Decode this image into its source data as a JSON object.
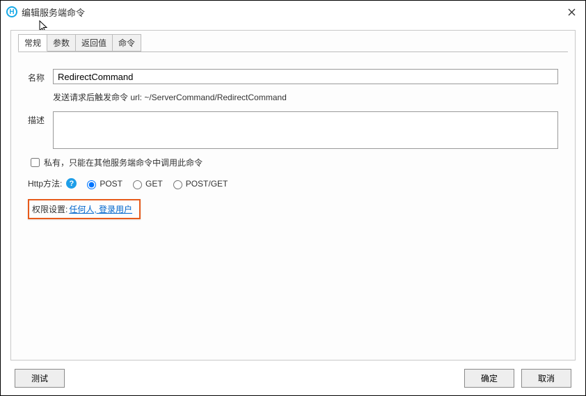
{
  "window": {
    "title": "编辑服务端命令"
  },
  "tabs": {
    "general": "常规",
    "params": "参数",
    "returns": "返回值",
    "command": "命令"
  },
  "form": {
    "name_label": "名称",
    "name_value": "RedirectCommand",
    "hint": "发送请求后触发命令 url: ~/ServerCommand/RedirectCommand",
    "desc_label": "描述",
    "desc_value": "",
    "private_label": "私有，只能在其他服务端命令中调用此命令",
    "http_label": "Http方法:",
    "http_options": {
      "post": "POST",
      "get": "GET",
      "postget": "POST/GET"
    },
    "perm_label": "权限设置:",
    "perm_link": "任何人, 登录用户"
  },
  "buttons": {
    "test": "测试",
    "ok": "确定",
    "cancel": "取消"
  }
}
